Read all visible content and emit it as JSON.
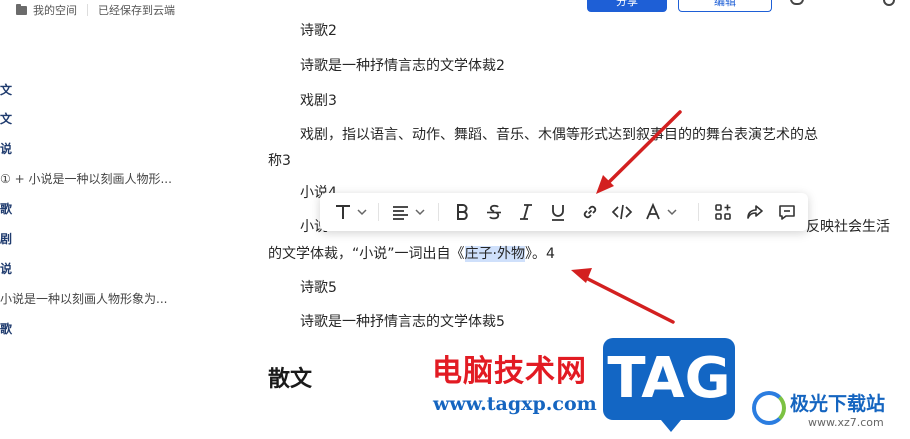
{
  "header": {
    "breadcrumb_space": "我的空间",
    "save_status": "已经保存到云端",
    "share_label": "分享",
    "edit_label": "编辑"
  },
  "outline": {
    "items": [
      {
        "label": "文"
      },
      {
        "label": "文"
      },
      {
        "label": "说"
      },
      {
        "label": "① + 小说是一种以刻画人物形..."
      },
      {
        "label": "歌"
      },
      {
        "label": "剧"
      },
      {
        "label": "说"
      },
      {
        "label": "小说是一种以刻画人物形象为..."
      },
      {
        "label": "歌"
      }
    ]
  },
  "document": {
    "lines": [
      "诗歌2",
      "诗歌是一种抒情言志的文学体裁2",
      "戏剧3",
      "戏剧，指以语言、动作、舞蹈、音乐、木偶等形式达到叙事目的的舞台表演艺术的总",
      "称3",
      "小说4",
      "小说",
      "反映社会生活",
      "的文学体裁，“小说”一词出自《",
      "庄子·外物",
      "》。4",
      "诗歌5",
      "诗歌是一种抒情言志的文学体裁5"
    ],
    "heading": "散文"
  },
  "toolbar": {
    "buttons": [
      {
        "name": "text-style",
        "icon": "text-style-icon"
      },
      {
        "name": "align",
        "icon": "align-icon"
      },
      {
        "name": "bold",
        "icon": "bold-icon"
      },
      {
        "name": "strikethrough",
        "icon": "strikethrough-icon"
      },
      {
        "name": "italic",
        "icon": "italic-icon"
      },
      {
        "name": "underline",
        "icon": "underline-icon"
      },
      {
        "name": "link",
        "icon": "link-icon"
      },
      {
        "name": "code",
        "icon": "code-icon"
      },
      {
        "name": "font-color",
        "icon": "font-color-icon"
      },
      {
        "name": "apps",
        "icon": "apps-icon"
      },
      {
        "name": "share",
        "icon": "share-icon"
      },
      {
        "name": "comment",
        "icon": "comment-icon"
      }
    ]
  },
  "watermark": {
    "cn": "电脑技术网",
    "url": "www.tagxp.com",
    "tag": "TAG",
    "xz_name": "极光下载站",
    "xz_url": "www.xz7.com"
  },
  "colors": {
    "accent": "#1e5fd6",
    "arrow": "#d32020",
    "selection": "#cfe0fb",
    "watermark_red": "#e21b23",
    "watermark_blue": "#1366c4"
  }
}
